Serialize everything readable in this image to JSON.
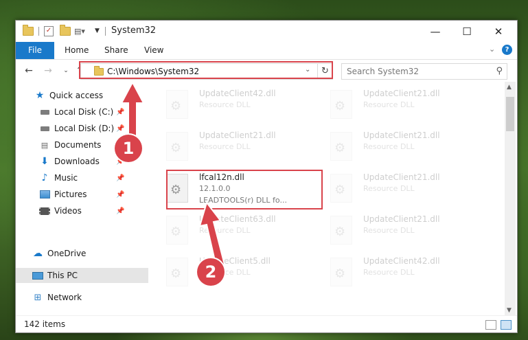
{
  "window": {
    "title": "System32",
    "minimize": "—",
    "maximize": "☐",
    "close": "✕"
  },
  "ribbon": {
    "tabs": [
      "File",
      "Home",
      "Share",
      "View"
    ]
  },
  "address": {
    "path": "C:\\Windows\\System32",
    "search_placeholder": "Search System32"
  },
  "nav": {
    "items": [
      {
        "label": "Quick access",
        "icon": "star-icon"
      },
      {
        "label": "Local Disk (C:)",
        "icon": "drive-icon"
      },
      {
        "label": "Local Disk (D:)",
        "icon": "drive-icon"
      },
      {
        "label": "Documents",
        "icon": "documents-icon"
      },
      {
        "label": "Downloads",
        "icon": "downloads-icon"
      },
      {
        "label": "Music",
        "icon": "music-icon"
      },
      {
        "label": "Pictures",
        "icon": "pictures-icon"
      },
      {
        "label": "Videos",
        "icon": "videos-icon"
      },
      {
        "label": "OneDrive",
        "icon": "cloud-icon"
      },
      {
        "label": "This PC",
        "icon": "pc-icon"
      },
      {
        "label": "Network",
        "icon": "network-icon"
      }
    ]
  },
  "files": {
    "left": [
      {
        "name": "UpdateClient42.dll",
        "desc": "Resource DLL"
      },
      {
        "name": "UpdateClient21.dll",
        "desc": "Resource DLL"
      },
      {
        "name": "lfcal12n.dll",
        "desc": "12.1.0.0",
        "desc2": "LEADTOOLS(r) DLL fo..."
      },
      {
        "name": "UpdateClient63.dll",
        "desc": "Resource DLL"
      },
      {
        "name": "UpdateClient5.dll",
        "desc": "Resource DLL"
      }
    ],
    "right": [
      {
        "name": "UpdateClient21.dll",
        "desc": "Resource DLL"
      },
      {
        "name": "UpdateClient21.dll",
        "desc": "Resource DLL"
      },
      {
        "name": "UpdateClient21.dll",
        "desc": "Resource DLL"
      },
      {
        "name": "UpdateClient21.dll",
        "desc": "Resource DLL"
      },
      {
        "name": "UpdateClient42.dll",
        "desc": "Resource DLL"
      }
    ]
  },
  "status": {
    "count": "142 items"
  },
  "annotations": {
    "step1": "1",
    "step2": "2",
    "color": "#d9434b"
  }
}
